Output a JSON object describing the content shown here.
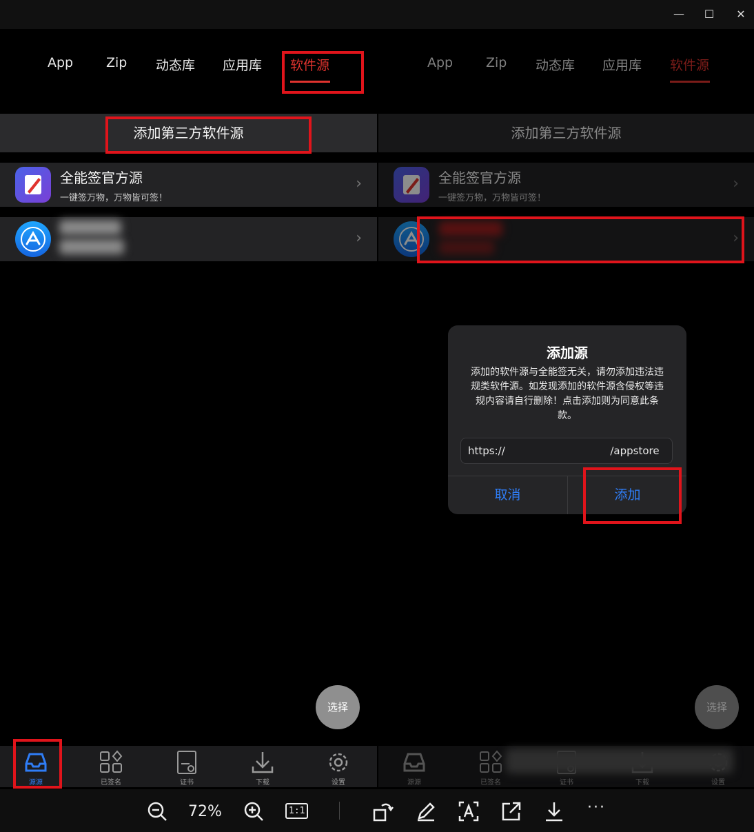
{
  "window": {
    "minimize": "—",
    "maximize": "☐",
    "close": "✕"
  },
  "tabs": [
    "App",
    "Zip",
    "动态库",
    "应用库",
    "软件源"
  ],
  "active_tab": "软件源",
  "add_source_label": "添加第三方软件源",
  "sources": [
    {
      "name": "全能签官方源",
      "subtitle": "一键签万物，万物皆可签！",
      "icon": "pen-app-icon"
    },
    {
      "name": "",
      "subtitle": "",
      "icon": "app-store-icon"
    }
  ],
  "select_button": "选择",
  "nav": [
    {
      "label": "源源",
      "icon": "inbox-icon"
    },
    {
      "label": "已签名",
      "icon": "apps-grid-icon"
    },
    {
      "label": "证书",
      "icon": "certificate-icon"
    },
    {
      "label": "下载",
      "icon": "download-icon"
    },
    {
      "label": "设置",
      "icon": "gear-icon"
    }
  ],
  "dialog": {
    "title": "添加源",
    "message": "添加的软件源与全能签无关，请勿添加违法违规类软件源。如发现添加的软件源含侵权等违规内容请自行删除！点击添加则为同意此条款。",
    "input_value": "https://                                /appstore",
    "cancel": "取消",
    "confirm": "添加"
  },
  "viewer": {
    "zoom": "72%",
    "actual_size": "1:1",
    "more": "···"
  },
  "colors": {
    "accent": "#e0332e",
    "link": "#2f7df6",
    "highlight_box": "#e0141b"
  }
}
